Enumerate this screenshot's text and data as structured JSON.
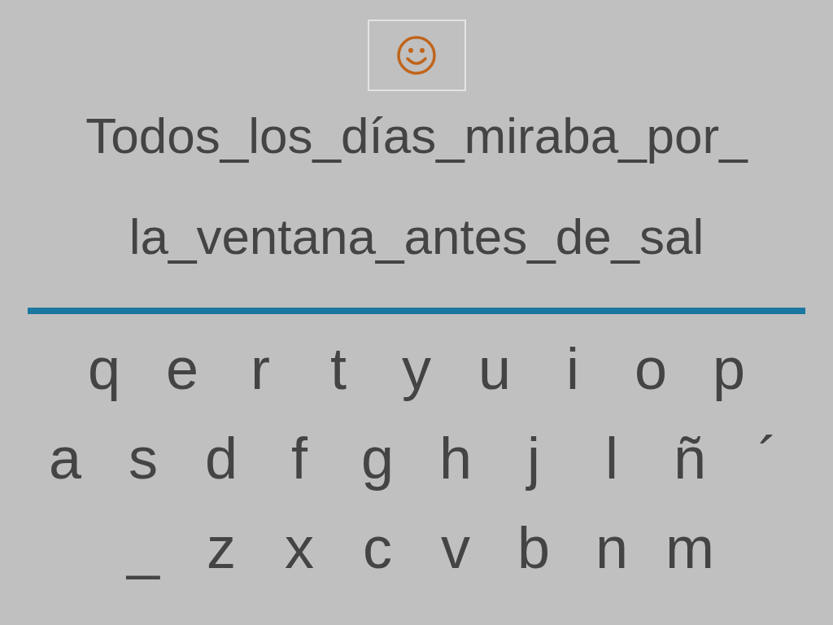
{
  "phrase_lines": [
    "Todos_los_días_miraba_por_",
    "la_ventana_antes_de_sal"
  ],
  "keyboard_rows": [
    [
      "q",
      "e",
      "r",
      "t",
      "y",
      "u",
      "i",
      "o",
      "p"
    ],
    [
      "a",
      "s",
      "d",
      "f",
      "g",
      "h",
      "j",
      "l",
      "ñ",
      "´"
    ],
    [
      "_",
      "z",
      "x",
      "c",
      "v",
      "b",
      "n",
      "m"
    ]
  ]
}
